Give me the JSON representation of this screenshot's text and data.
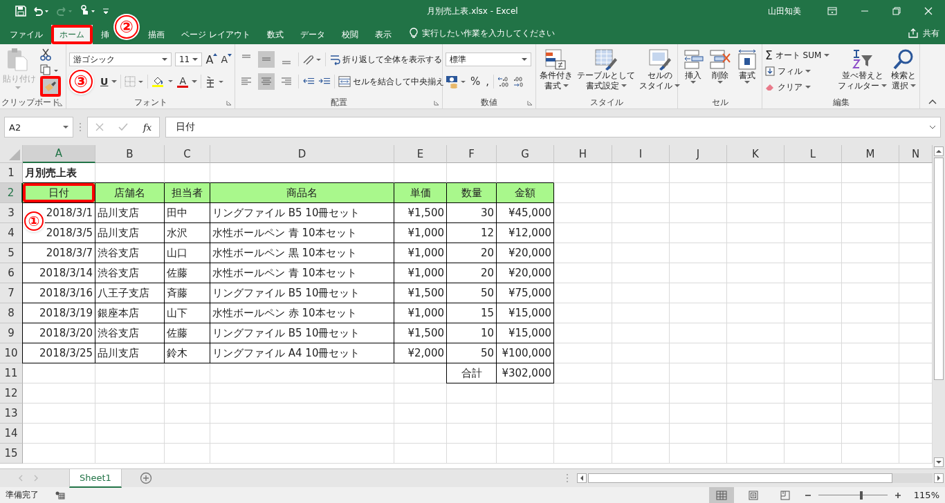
{
  "title_bar": {
    "document_title": "月別売上表.xlsx  -  Excel",
    "user": "山田知美"
  },
  "ribbon_tabs": [
    {
      "label": "ファイル",
      "selected": false
    },
    {
      "label": "ホーム",
      "selected": true
    },
    {
      "label": "挿",
      "selected": false
    },
    {
      "label": "描画",
      "selected": false
    },
    {
      "label": "ページ レイアウト",
      "selected": false
    },
    {
      "label": "数式",
      "selected": false
    },
    {
      "label": "データ",
      "selected": false
    },
    {
      "label": "校閲",
      "selected": false
    },
    {
      "label": "表示",
      "selected": false
    }
  ],
  "tell_me": {
    "placeholder": "実行したい作業を入力してください"
  },
  "share": "共有",
  "ribbon": {
    "clipboard": {
      "paste": "貼り付け",
      "group": "クリップボード"
    },
    "font": {
      "name": "游ゴシック",
      "size": "11",
      "grow": "A",
      "shrink": "A",
      "underline": "U",
      "font_color_button": "A",
      "group": "フォント"
    },
    "alignment": {
      "vertical": [
        {
          "selected": false
        },
        {
          "selected": true
        },
        {
          "selected": false
        }
      ],
      "horizontal": [
        {
          "selected": false
        },
        {
          "selected": true
        },
        {
          "selected": false
        }
      ],
      "wrap": "折り返して全体を表示する",
      "merge": "セルを結合して中央揃え",
      "group": "配置"
    },
    "number": {
      "format": "標準",
      "percent": "%",
      "comma": ",",
      "group": "数値"
    },
    "styles": {
      "buttons": [
        {
          "lines": [
            "条件付き",
            "書式"
          ]
        },
        {
          "lines": [
            "テーブルとして",
            "書式設定"
          ]
        },
        {
          "lines": [
            "セルの",
            "スタイル"
          ]
        }
      ],
      "group": "スタイル"
    },
    "cells": {
      "buttons": [
        "挿入",
        "削除",
        "書式"
      ],
      "group": "セル"
    },
    "editing": {
      "sigma": "Σ",
      "autosum": "オート SUM",
      "fill": "フィル",
      "clear": "クリア",
      "sort": [
        "並べ替えと",
        "フィルター"
      ],
      "find": [
        "検索と",
        "選択"
      ],
      "group": "編集"
    }
  },
  "formula_bar": {
    "name_box": "A2",
    "fx": "fx",
    "value": "日付"
  },
  "columns": [
    {
      "label": "A",
      "selected": true
    },
    {
      "label": "B",
      "selected": false
    },
    {
      "label": "C",
      "selected": false
    },
    {
      "label": "D",
      "selected": false
    },
    {
      "label": "E",
      "selected": false
    },
    {
      "label": "F",
      "selected": false
    },
    {
      "label": "G",
      "selected": false
    },
    {
      "label": "H",
      "selected": false
    },
    {
      "label": "I",
      "selected": false
    },
    {
      "label": "J",
      "selected": false
    },
    {
      "label": "K",
      "selected": false
    },
    {
      "label": "L",
      "selected": false
    },
    {
      "label": "M",
      "selected": false
    },
    {
      "label": "N",
      "selected": false
    }
  ],
  "rows": [
    {
      "number": "1",
      "selected": false,
      "kind": "title",
      "text": "月別売上表"
    },
    {
      "number": "2",
      "selected": true,
      "kind": "header",
      "cells": [
        "日付",
        "店舗名",
        "担当者",
        "商品名",
        "単価",
        "数量",
        "金額"
      ]
    },
    {
      "number": "3",
      "selected": false,
      "kind": "data",
      "cells": [
        "2018/3/1",
        "品川支店",
        "田中",
        "リングファイル B5 10冊セット",
        "¥1,500",
        "30",
        "¥45,000"
      ]
    },
    {
      "number": "4",
      "selected": false,
      "kind": "data",
      "cells": [
        "2018/3/5",
        "品川支店",
        "水沢",
        "水性ボールペン 青 10本セット",
        "¥1,000",
        "12",
        "¥12,000"
      ]
    },
    {
      "number": "5",
      "selected": false,
      "kind": "data",
      "cells": [
        "2018/3/7",
        "渋谷支店",
        "山口",
        "水性ボールペン 黒 10本セット",
        "¥1,000",
        "20",
        "¥20,000"
      ]
    },
    {
      "number": "6",
      "selected": false,
      "kind": "data",
      "cells": [
        "2018/3/14",
        "渋谷支店",
        "佐藤",
        "水性ボールペン 青 10本セット",
        "¥1,000",
        "20",
        "¥20,000"
      ]
    },
    {
      "number": "7",
      "selected": false,
      "kind": "data",
      "cells": [
        "2018/3/16",
        "八王子支店",
        "斉藤",
        "リングファイル B5 10冊セット",
        "¥1,500",
        "50",
        "¥75,000"
      ]
    },
    {
      "number": "8",
      "selected": false,
      "kind": "data",
      "cells": [
        "2018/3/19",
        "銀座本店",
        "山下",
        "水性ボールペン 赤 10本セット",
        "¥1,000",
        "15",
        "¥15,000"
      ]
    },
    {
      "number": "9",
      "selected": false,
      "kind": "data",
      "cells": [
        "2018/3/20",
        "渋谷支店",
        "佐藤",
        "リングファイル B5 10冊セット",
        "¥1,500",
        "10",
        "¥15,000"
      ]
    },
    {
      "number": "10",
      "selected": false,
      "kind": "data",
      "cells": [
        "2018/3/25",
        "品川支店",
        "鈴木",
        "リングファイル A4 10冊セット",
        "¥2,000",
        "50",
        "¥100,000"
      ]
    },
    {
      "number": "11",
      "selected": false,
      "kind": "total",
      "label": "合計",
      "value": "¥302,000"
    },
    {
      "number": "12",
      "selected": false,
      "kind": "empty"
    },
    {
      "number": "13",
      "selected": false,
      "kind": "empty"
    },
    {
      "number": "14",
      "selected": false,
      "kind": "empty"
    },
    {
      "number": "15",
      "selected": false,
      "kind": "empty"
    }
  ],
  "sheet_tabs": [
    {
      "label": "Sheet1",
      "selected": true
    }
  ],
  "status_bar": {
    "status": "準備完了",
    "zoom_slider": {
      "level": 0.62
    },
    "zoom": "115%"
  },
  "callouts": [
    {
      "label": "①"
    },
    {
      "label": "②"
    },
    {
      "label": "③"
    }
  ]
}
